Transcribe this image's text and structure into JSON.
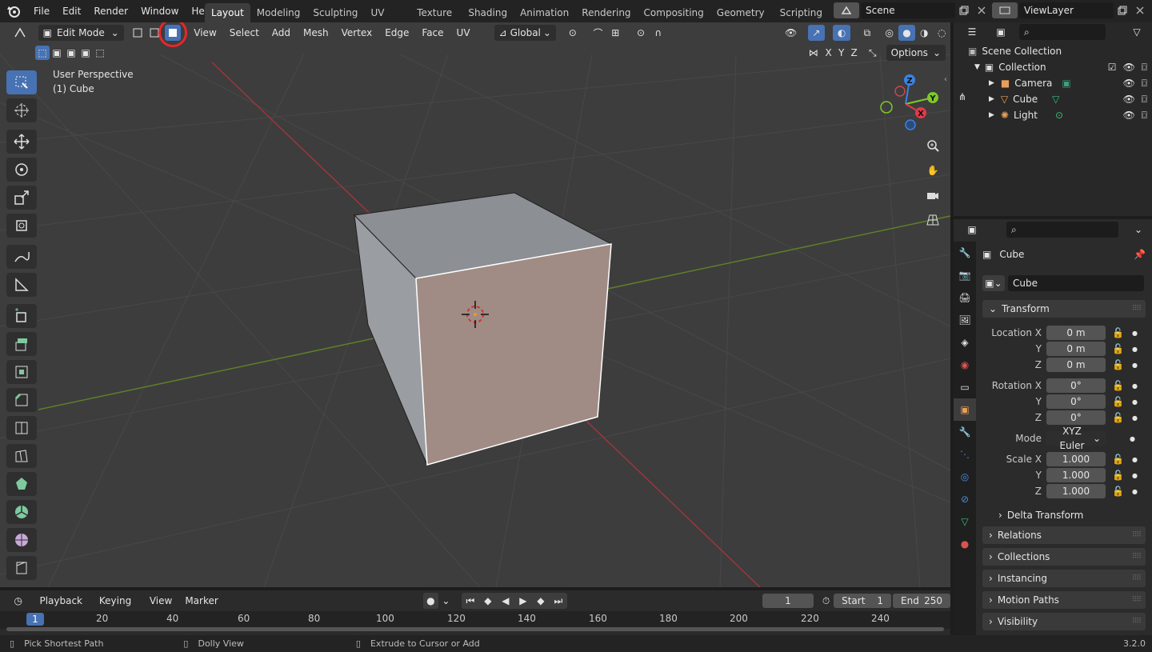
{
  "app": {
    "logo": "blender-logo-icon",
    "version": "3.2.0"
  },
  "menu": [
    "File",
    "Edit",
    "Render",
    "Window",
    "Help"
  ],
  "workspaces": [
    "Layout",
    "Modeling",
    "Sculpting",
    "UV Editing",
    "Texture Paint",
    "Shading",
    "Animation",
    "Rendering",
    "Compositing",
    "Geometry Nodes",
    "Scripting"
  ],
  "active_workspace": "Layout",
  "scene": {
    "name": "Scene",
    "view_layer": "ViewLayer"
  },
  "viewport": {
    "mode": "Edit Mode",
    "menus": [
      "View",
      "Select",
      "Add",
      "Mesh",
      "Vertex",
      "Edge",
      "Face",
      "UV"
    ],
    "transform_orientation": "Global",
    "options_label": "Options",
    "axes": [
      "X",
      "Y",
      "Z"
    ],
    "perspective_label": "User Perspective",
    "object_label": "(1) Cube",
    "gizmo": {
      "z": "Z",
      "y": "Y",
      "x": "X"
    },
    "select_mode_active": "face"
  },
  "timeline": {
    "menus": [
      "Playback",
      "Keying",
      "View",
      "Marker"
    ],
    "current_frame": "1",
    "start_label": "Start",
    "start": "1",
    "end_label": "End",
    "end": "250",
    "ruler_current": "1",
    "ruler_ticks": [
      "20",
      "40",
      "60",
      "80",
      "100",
      "120",
      "140",
      "160",
      "180",
      "200",
      "220",
      "240"
    ]
  },
  "status": {
    "left": "Pick Shortest Path",
    "middle": "Dolly View",
    "right": "Extrude to Cursor or Add",
    "version": "3.2.0"
  },
  "outliner": {
    "root": "Scene Collection",
    "collection": "Collection",
    "items": [
      {
        "name": "Camera",
        "icon": "camera-icon"
      },
      {
        "name": "Cube",
        "icon": "mesh-icon"
      },
      {
        "name": "Light",
        "icon": "light-icon"
      }
    ]
  },
  "properties": {
    "object_name": "Cube",
    "data_name": "Cube",
    "transform_title": "Transform",
    "location_label": "Location X",
    "rotation_label": "Rotation X",
    "scale_label": "Scale X",
    "y_label": "Y",
    "z_label": "Z",
    "location": [
      "0 m",
      "0 m",
      "0 m"
    ],
    "rotation": [
      "0°",
      "0°",
      "0°"
    ],
    "mode_label": "Mode",
    "mode_value": "XYZ Euler",
    "scale": [
      "1.000",
      "1.000",
      "1.000"
    ],
    "delta_transform": "Delta Transform",
    "panels": [
      "Relations",
      "Collections",
      "Instancing",
      "Motion Paths",
      "Visibility"
    ]
  },
  "colors": {
    "accent": "#4772b3",
    "highlight_ring": "#e8262a",
    "x_axis": "#e13a48",
    "y_axis": "#7ec92a",
    "z_axis": "#3b82e6"
  }
}
